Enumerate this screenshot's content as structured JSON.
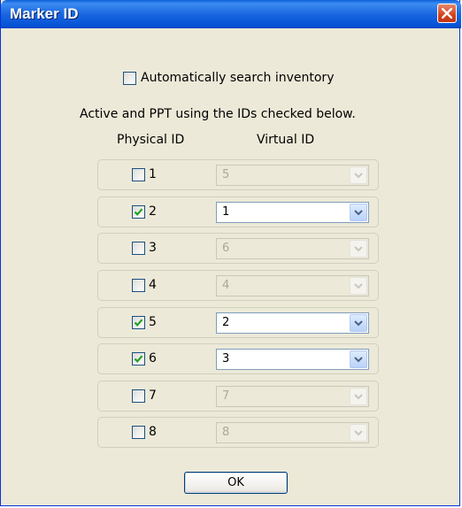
{
  "window": {
    "title": "Marker ID"
  },
  "options": {
    "auto_search_label": "Automatically search inventory",
    "auto_search_checked": false
  },
  "instructions": "Active and PPT using the IDs checked below.",
  "headers": {
    "physical": "Physical ID",
    "virtual": "Virtual ID"
  },
  "rows": [
    {
      "physical": "1",
      "checked": false,
      "virtual": "5",
      "enabled": false
    },
    {
      "physical": "2",
      "checked": true,
      "virtual": "1",
      "enabled": true
    },
    {
      "physical": "3",
      "checked": false,
      "virtual": "6",
      "enabled": false
    },
    {
      "physical": "4",
      "checked": false,
      "virtual": "4",
      "enabled": false
    },
    {
      "physical": "5",
      "checked": true,
      "virtual": "2",
      "enabled": true
    },
    {
      "physical": "6",
      "checked": true,
      "virtual": "3",
      "enabled": true
    },
    {
      "physical": "7",
      "checked": false,
      "virtual": "7",
      "enabled": false
    },
    {
      "physical": "8",
      "checked": false,
      "virtual": "8",
      "enabled": false
    }
  ],
  "buttons": {
    "ok": "OK"
  },
  "colors": {
    "titlebar": "#0a5fd8",
    "dialog_bg": "#ece9d8",
    "check_green": "#21a121",
    "close_red": "#d3431c"
  },
  "icons": {
    "close": "close-icon",
    "dropdown": "chevron-down-icon",
    "check": "checkmark-icon"
  }
}
